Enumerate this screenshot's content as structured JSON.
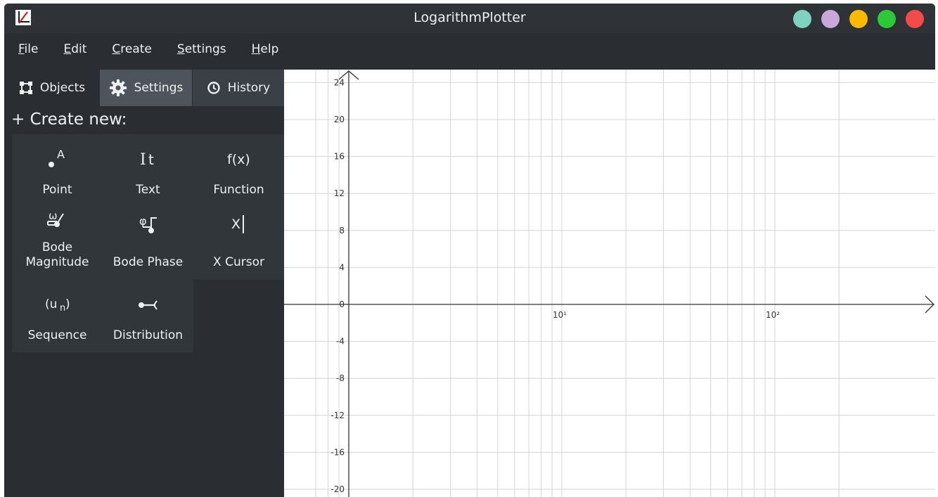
{
  "window": {
    "title": "LogarithmPlotter",
    "buttons": [
      {
        "name": "teal",
        "color": "#7fd1c2"
      },
      {
        "name": "lilac",
        "color": "#c8a8d9"
      },
      {
        "name": "yellow",
        "color": "#fbb900"
      },
      {
        "name": "green",
        "color": "#2ec938"
      },
      {
        "name": "red",
        "color": "#f34a4a"
      }
    ]
  },
  "menubar": {
    "items": [
      {
        "mnemonic": "F",
        "rest": "ile"
      },
      {
        "mnemonic": "E",
        "rest": "dit"
      },
      {
        "mnemonic": "C",
        "rest": "reate"
      },
      {
        "mnemonic": "S",
        "rest": "ettings"
      },
      {
        "mnemonic": "H",
        "rest": "elp"
      }
    ]
  },
  "sidebar": {
    "tabs": [
      {
        "label": "Objects",
        "icon": "objects-icon"
      },
      {
        "label": "Settings",
        "icon": "gear-icon"
      },
      {
        "label": "History",
        "icon": "clock-icon"
      }
    ],
    "create_title": "+ Create new:",
    "create_items": [
      {
        "label": "Point",
        "icon": "point-icon",
        "glyph": "•ᴬ"
      },
      {
        "label": "Text",
        "icon": "text-icon",
        "glyph": "It"
      },
      {
        "label": "Function",
        "icon": "function-icon",
        "glyph": "f(x)"
      },
      {
        "label": "Bode Magnitude",
        "icon": "bode-magnitude-icon",
        "glyph": "ω"
      },
      {
        "label": "Bode Phase",
        "icon": "bode-phase-icon",
        "glyph": "φ"
      },
      {
        "label": "X Cursor",
        "icon": "x-cursor-icon",
        "glyph": "X|"
      },
      {
        "label": "Sequence",
        "icon": "sequence-icon",
        "glyph": "(uₙ)"
      },
      {
        "label": "Distribution",
        "icon": "distribution-icon",
        "glyph": "⊸"
      }
    ]
  },
  "chart_data": {
    "type": "line",
    "x_scale": "log",
    "xlim": [
      0.7,
      200
    ],
    "ylim": [
      -21,
      24.5
    ],
    "x_tick_labels": [
      "10¹",
      "10²"
    ],
    "x_tick_values": [
      10,
      100
    ],
    "y_tick_values": [
      24,
      20,
      16,
      12,
      8,
      4,
      0,
      -4,
      -8,
      -12,
      -16,
      -20
    ],
    "grid": true,
    "series": []
  }
}
